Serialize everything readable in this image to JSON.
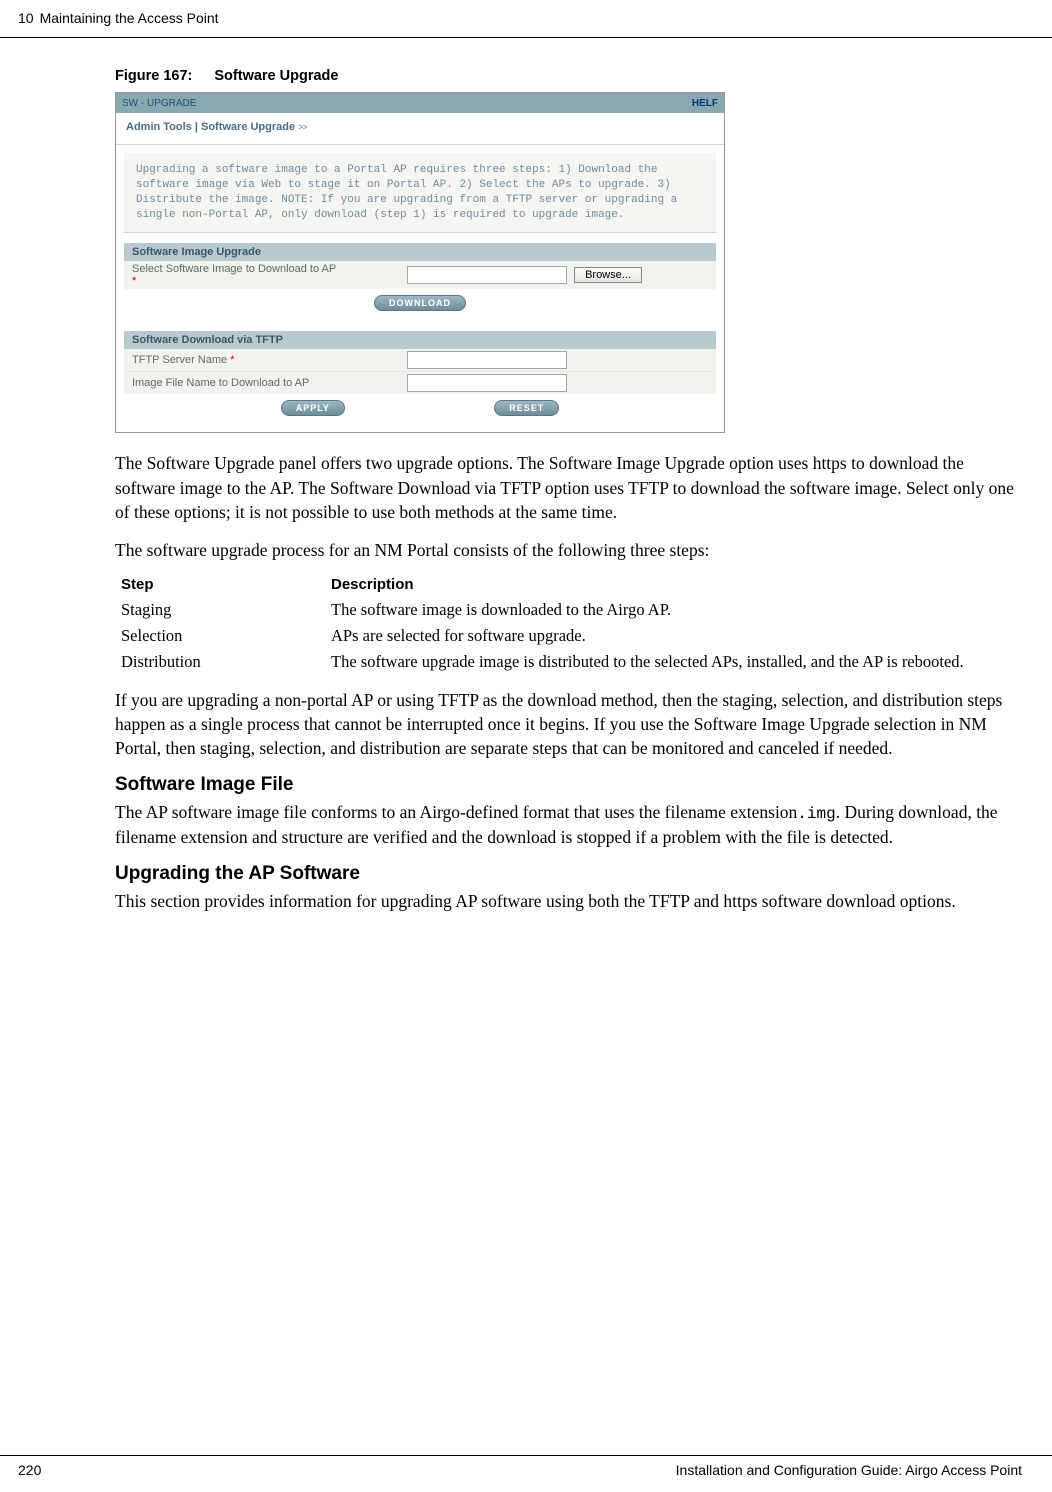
{
  "header": {
    "chapter_number": "10",
    "chapter_title": "Maintaining the Access Point"
  },
  "figure": {
    "label": "Figure 167:",
    "title": "Software Upgrade"
  },
  "screenshot": {
    "topbar_left": "SW - UPGRADE",
    "topbar_right": "HELF",
    "breadcrumb": "Admin Tools | Software Upgrade",
    "breadcrumb_arrows": ">>",
    "description": "Upgrading a software image to a Portal AP requires three steps: 1) Download the software image via Web to stage it on Portal AP. 2) Select the APs to upgrade. 3) Distribute the image. NOTE: If you are upgrading from a TFTP server or upgrading a single non-Portal AP, only download (step 1) is required to upgrade image.",
    "section1_title": "Software Image Upgrade",
    "section1_label": "Select Software Image to Download to AP",
    "browse_label": "Browse...",
    "download_label": "DOWNLOAD",
    "section2_title": "Software Download via TFTP",
    "row_tftp_label": "TFTP Server Name",
    "row_image_label": "Image File Name to Download to AP",
    "apply_label": "APPLY",
    "reset_label": "RESET",
    "required_marker": "*"
  },
  "paragraphs": {
    "p1": "The Software Upgrade panel offers two upgrade options. The Software Image Upgrade option uses https to download the software image to the AP. The Software Download via TFTP option uses TFTP to download the software image. Select only one of these options; it is not possible to use both methods at the same time.",
    "p2": "The software upgrade process for an NM Portal consists of the following three steps:",
    "p3": "If you are upgrading a non-portal AP or using TFTP as the download method, then the staging, selection, and distribution steps happen as a single process that cannot be interrupted once it begins. If you use the Software Image Upgrade selection in NM Portal, then staging, selection, and distribution are separate steps that can be monitored and canceled if needed.",
    "p4a": "The AP software image file conforms to an Airgo-defined format that uses the filename extension",
    "p4_code": ".img",
    "p4b": ". During download, the filename extension and structure are verified and the download is stopped if a problem with the file is detected.",
    "p5": "This section provides information for upgrading AP software using both the TFTP and https software download options."
  },
  "steps": {
    "header_step": "Step",
    "header_desc": "Description",
    "rows": [
      {
        "step": "Staging",
        "desc": "The software image is downloaded to the Airgo AP."
      },
      {
        "step": "Selection",
        "desc": "APs are selected for software upgrade."
      },
      {
        "step": "Distribution",
        "desc": "The software upgrade image is distributed to the selected APs, installed, and the AP is rebooted."
      }
    ]
  },
  "headings": {
    "h3_a": "Software Image File",
    "h3_b": "Upgrading the AP Software"
  },
  "footer": {
    "page": "220",
    "doc_title": "Installation and Configuration Guide: Airgo Access Point"
  }
}
